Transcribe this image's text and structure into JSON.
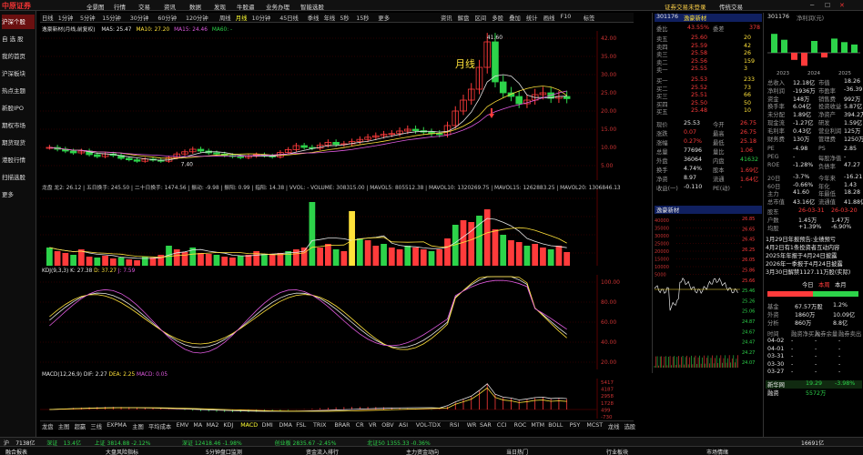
{
  "app": {
    "logo": "中原证券",
    "user_status": "证券交易未登录",
    "edition": "传统交易"
  },
  "menu": [
    "全景图",
    "行情",
    "交易",
    "资讯",
    "数据",
    "发现",
    "牛股逼",
    "业务办理",
    "智能选股"
  ],
  "sidebar": [
    {
      "label": "沪深个股",
      "active": true
    },
    {
      "label": "自 选 股",
      "active": false
    },
    {
      "label": "我的首页",
      "active": false
    },
    {
      "label": "沪深板块",
      "active": false
    },
    {
      "label": "热点主题",
      "active": false
    },
    {
      "label": "新股IPO",
      "active": false
    },
    {
      "label": "期权市场",
      "active": false
    },
    {
      "label": "期货现货",
      "active": false
    },
    {
      "label": "港股行情",
      "active": false
    },
    {
      "label": "扫描选股",
      "active": false
    },
    {
      "label": "更多",
      "active": false
    }
  ],
  "periods": [
    {
      "label": "日线",
      "active": false
    },
    {
      "label": "1分钟",
      "active": false
    },
    {
      "label": "5分钟",
      "active": false
    },
    {
      "label": "15分钟",
      "active": false
    },
    {
      "label": "30分钟",
      "active": false
    },
    {
      "label": "60分钟",
      "active": false
    },
    {
      "label": "120分钟",
      "active": false
    },
    {
      "label": "周线",
      "active": false
    },
    {
      "label": "月线",
      "active": true
    },
    {
      "label": "10分钟",
      "active": false
    },
    {
      "label": "45日线",
      "active": false
    },
    {
      "label": "季线",
      "active": false
    },
    {
      "label": "年线",
      "active": false
    },
    {
      "label": "5秒",
      "active": false
    },
    {
      "label": "15秒",
      "active": false
    },
    {
      "label": "更多",
      "active": false
    }
  ],
  "toolbar_right": [
    "资讯",
    "解盘",
    "区间",
    "多股",
    "叠加",
    "统计",
    "画线",
    "F10",
    "标签"
  ],
  "kline": {
    "header": "逸豪新材(月线,前复权)",
    "ma": [
      {
        "label": "MA5: 25.47",
        "color": "#e6e6e6"
      },
      {
        "label": "MA10: 27.20",
        "color": "#ffe23a"
      },
      {
        "label": "MA15: 24.46",
        "color": "#e05ae0"
      },
      {
        "label": "MA60: -",
        "color": "#2dd34a"
      }
    ],
    "annotation": "月线",
    "high_label": "41.60",
    "low_label": "7.40"
  },
  "volume": {
    "header": "龙盘 龙2: 26.12 | 五日换手: 245.50 | 二十日换手: 1474.56 | 振动: -9.98 | 振阳: 0.99 | 指阳: 14.38 | VVOL: - VOLUME: 308315.00 | MAVOL5: 805512.38 | MAVOL10: 1320269.75 | MAVOL15: 1262883.25 | MAVOL20: 1306846.13"
  },
  "kdj": {
    "header": "KDJ(9,3,3)",
    "k": "K: 27.38",
    "d": "D: 37.27",
    "j": "J: 7.59"
  },
  "macd": {
    "header": "MACD(12,26,9)",
    "dif": "DIF: 2.27",
    "dea": "DEA: 2.25",
    "macd": "MACD: 0.05"
  },
  "bottom_tabs": [
    "龙盘",
    "主图",
    "超赢",
    "三线",
    "EXPMA",
    "主图",
    "平均成本",
    "EMV",
    "MA",
    "MA2",
    "KDJ",
    "MACD",
    "DMI",
    "DMA",
    "FSL",
    "TRIX",
    "BRAR",
    "CR",
    "VR",
    "OBV",
    "ASI",
    "VOL-TDX",
    "RSI",
    "WR",
    "SAR",
    "CCI",
    "ROC",
    "MTM",
    "BOLL",
    "PSY",
    "MCST",
    "龙线",
    "选股"
  ],
  "stock": {
    "code": "301176",
    "name": "逸豪新材"
  },
  "orderbook": {
    "wei_bi_label": "委比",
    "wei_bi": "43.55%",
    "wei_cha_label": "委差",
    "wei_cha": "378",
    "sells": [
      [
        "卖五",
        "25.60",
        "20"
      ],
      [
        "卖四",
        "25.59",
        "42"
      ],
      [
        "卖三",
        "25.58",
        "26"
      ],
      [
        "卖二",
        "25.56",
        "159"
      ],
      [
        "卖一",
        "25.55",
        "3"
      ]
    ],
    "buys": [
      [
        "买一",
        "25.53",
        "233"
      ],
      [
        "买二",
        "25.52",
        "73"
      ],
      [
        "买三",
        "25.51",
        "66"
      ],
      [
        "买四",
        "25.50",
        "50"
      ],
      [
        "买五",
        "25.48",
        "10"
      ]
    ]
  },
  "stats": [
    [
      "现价",
      "25.53",
      "今开",
      "26.75"
    ],
    [
      "涨跌",
      "0.07",
      "最高",
      "26.75"
    ],
    [
      "涨幅",
      "0.27%",
      "最低",
      "25.18"
    ],
    [
      "总量",
      "77696",
      "量比",
      "1.06"
    ],
    [
      "外盘",
      "36064",
      "内盘",
      "41632"
    ],
    [
      "换手",
      "4.74%",
      "股本",
      "1.69亿"
    ],
    [
      "净资",
      "8.97",
      "流通",
      "1.64亿"
    ],
    [
      "收益(一)",
      "-0.110",
      "PE(动)",
      "-"
    ]
  ],
  "intraday_title": "逸豪新材",
  "intraday_prices": [
    "26.85",
    "26.65",
    "26.45",
    "26.25",
    "26.05",
    "25.86",
    "25.66",
    "25.46",
    "25.26",
    "25.06",
    "24.87",
    "24.67",
    "24.47",
    "24.27",
    "24.07"
  ],
  "intraday_vol_labels": [
    "40000",
    "35000",
    "30000",
    "25000",
    "20000",
    "15000",
    "10000",
    "5000"
  ],
  "kdj_ticks": [
    "100.00",
    "80.00",
    "60.00",
    "40.00",
    "20.00"
  ],
  "macd_ticks": [
    "5417",
    "4187",
    "2958",
    "1728",
    "499",
    "-730"
  ],
  "kline_ticks": [
    "42.00",
    "35.00",
    "30.00",
    "25.00",
    "20.00",
    "15.00",
    "10.00",
    "5.00"
  ],
  "fin_chart": {
    "years": [
      "2023",
      "2024",
      "2025"
    ],
    "label": "净利润(元)",
    "bars": [
      0.8,
      0.55,
      -0.3,
      -0.55,
      0.5,
      -0.2,
      0.6,
      0.45,
      0.35
    ]
  },
  "finance": [
    [
      "总收入",
      "12.18亿",
      "市值",
      "18.26"
    ],
    [
      "净利润",
      "-1936万",
      "市盈率",
      "-36.39"
    ],
    [
      "资金",
      "148万",
      "销售费",
      "992万"
    ],
    [
      "换手率",
      "6.04亿",
      "投资收益",
      "5.87亿"
    ],
    [
      "未分配",
      "1.89亿",
      "净资产",
      "394.2万"
    ],
    [
      "现金流",
      "-1.27亿",
      "研发",
      "1.59亿"
    ],
    [
      "毛利率",
      "0.43亿",
      "营业利润",
      "125万"
    ],
    [
      "财务费",
      "130万",
      "管理费",
      "1250万"
    ],
    [
      "PE",
      "-4.98",
      "PS",
      "2.85"
    ],
    [
      "PEG",
      "-",
      "每股净值",
      "-"
    ],
    [
      "ROE",
      "-1.28%",
      "负债率",
      "47.27"
    ],
    [
      "20日",
      "-3.7%",
      "今年来",
      "-16.21"
    ],
    [
      "60日",
      "-0.66%",
      "年化",
      "1.43"
    ],
    [
      "主力",
      "41.60",
      "年最低",
      "18.28"
    ],
    [
      "总市值",
      "43.16亿",
      "流通值",
      "41.88亿"
    ]
  ],
  "dates": [
    [
      "股东",
      "26-03-31",
      "26-03-20"
    ],
    [
      "户数",
      "1.45万",
      "1.47万"
    ],
    [
      "均股",
      "+1.39%",
      "-6.90%"
    ]
  ],
  "news": [
    "1月29日年报预告:业绩预亏",
    "4月2日有1条投资者互动内容",
    "2025年年报于4月24日披露",
    "2026年一季报于4月24日披露",
    "3月30日解禁1127.11万股(实际)"
  ],
  "flow": {
    "tabs": [
      "今日",
      "本周",
      "本月"
    ],
    "rows": [
      [
        "基金",
        "67.57万股",
        "1.2%"
      ],
      [
        "外资",
        "1860万",
        "10.09亿"
      ],
      [
        "分析",
        "860万",
        "8.8亿"
      ]
    ],
    "list_header": [
      "时间",
      "融资净买入",
      "融券余量",
      "融券卖出"
    ],
    "list": [
      [
        "04-02",
        "-",
        "-",
        "-"
      ],
      [
        "04-01",
        "-",
        "-",
        "-"
      ],
      [
        "03-31",
        "-",
        "-",
        "-"
      ],
      [
        "03-30",
        "-",
        "-",
        "-"
      ],
      [
        "03-27",
        "-",
        "-",
        "-"
      ]
    ],
    "foot": [
      [
        "新华网",
        "19.29",
        "-3.98%"
      ],
      [
        "融资",
        "5572万",
        ""
      ]
    ]
  },
  "status": {
    "items": [
      "沪",
      "7138亿",
      "深证",
      "13.4亿",
      "上证 3814.88 -2.12%",
      "深证 12418.46 -1.98%",
      "创业板 2835.67 -2.45%",
      "北证50 1355.33 -0.36%"
    ],
    "time": "16691亿"
  },
  "ticker": [
    "融合报表",
    "大盘风险指标",
    "5分钟盘口监测",
    "资金流入排行",
    "主力资金动向",
    "当日热门",
    "行业板块",
    "市场情绪"
  ],
  "colors": {
    "up": "#ff3b3b",
    "down": "#2dd34a",
    "bg": "#000000",
    "grid": "#3a0000",
    "accent": "#c81e1e"
  }
}
